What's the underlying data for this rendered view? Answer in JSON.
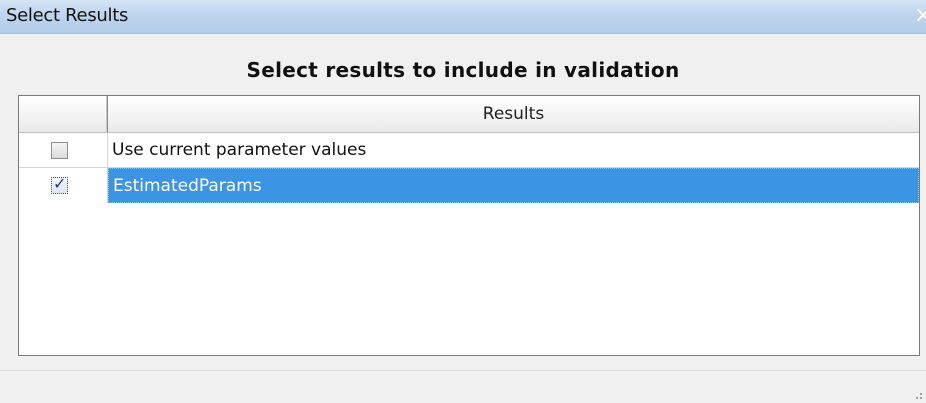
{
  "window": {
    "title": "Select Results",
    "close_glyph": "×"
  },
  "main": {
    "heading": "Select results to include in validation"
  },
  "table": {
    "columns": [
      "",
      "Results"
    ],
    "rows": [
      {
        "checked": false,
        "label": "Use current parameter values",
        "selected": false
      },
      {
        "checked": true,
        "label": "EstimatedParams",
        "selected": true
      }
    ]
  },
  "icons": {
    "close": "close-icon",
    "checkmark": "checkmark-icon",
    "resize_grip": "resize-grip-icon"
  },
  "colors": {
    "selection": "#3c94e4",
    "titlebar": "#bfd5ee"
  }
}
